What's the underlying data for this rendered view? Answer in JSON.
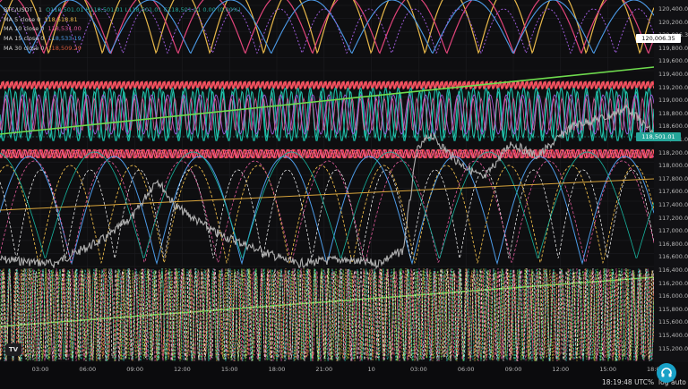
{
  "legend": {
    "symbol_line": {
      "symbol": "BTC/USDT · 1",
      "ohlc": "O118,501.01 H118,501.01 L118,501.01 C118,501.01 0.00 (0.00%)"
    },
    "indicators": [
      {
        "label": "MA 5 close 0",
        "value": "118,518.81",
        "color": "#e8b84a"
      },
      {
        "label": "MA 10 close 0",
        "value": "118,531.00",
        "color": "#e05a9a"
      },
      {
        "label": "MA 15 close 0",
        "value": "118,533.19",
        "color": "#4c9ae6"
      },
      {
        "label": "MA 30 close 0",
        "value": "118,509.29",
        "color": "#d45a3c"
      }
    ]
  },
  "price_axis": {
    "ticks": [
      "120,400.00",
      "120,200.00",
      "120,006.35",
      "119,800.00",
      "119,600.00",
      "119,400.00",
      "119,200.00",
      "119,000.00",
      "118,800.00",
      "118,600.00",
      "118,501.01",
      "118,200.00",
      "118,000.00",
      "117,800.00",
      "117,600.00",
      "117,400.00",
      "117,200.00",
      "117,000.00",
      "116,800.00",
      "116,600.00",
      "116,400.00",
      "116,200.00",
      "116,000.00",
      "115,800.00",
      "115,600.00",
      "115,400.00",
      "115,200.00"
    ],
    "high_tag": "120,006.35",
    "last_tag": "118,501.01"
  },
  "time_axis": {
    "ticks": [
      "03:00",
      "06:00",
      "09:00",
      "12:00",
      "15:00",
      "18:00",
      "21:00",
      "10",
      "03:00",
      "06:00",
      "09:00",
      "12:00",
      "15:00",
      "18:00"
    ]
  },
  "status_bar": {
    "clock": "18:19:48 UTC",
    "percent_label": "%",
    "log_label": "log",
    "auto_label": "auto"
  },
  "branding": {
    "logo_text": "TV"
  },
  "colors": {
    "background": "#0e0e10",
    "price_line": "#b0b0b0",
    "last_price_tag": "#26a69a",
    "high_tag": "#ffffff",
    "accent_headset": "#19a1c7"
  }
}
